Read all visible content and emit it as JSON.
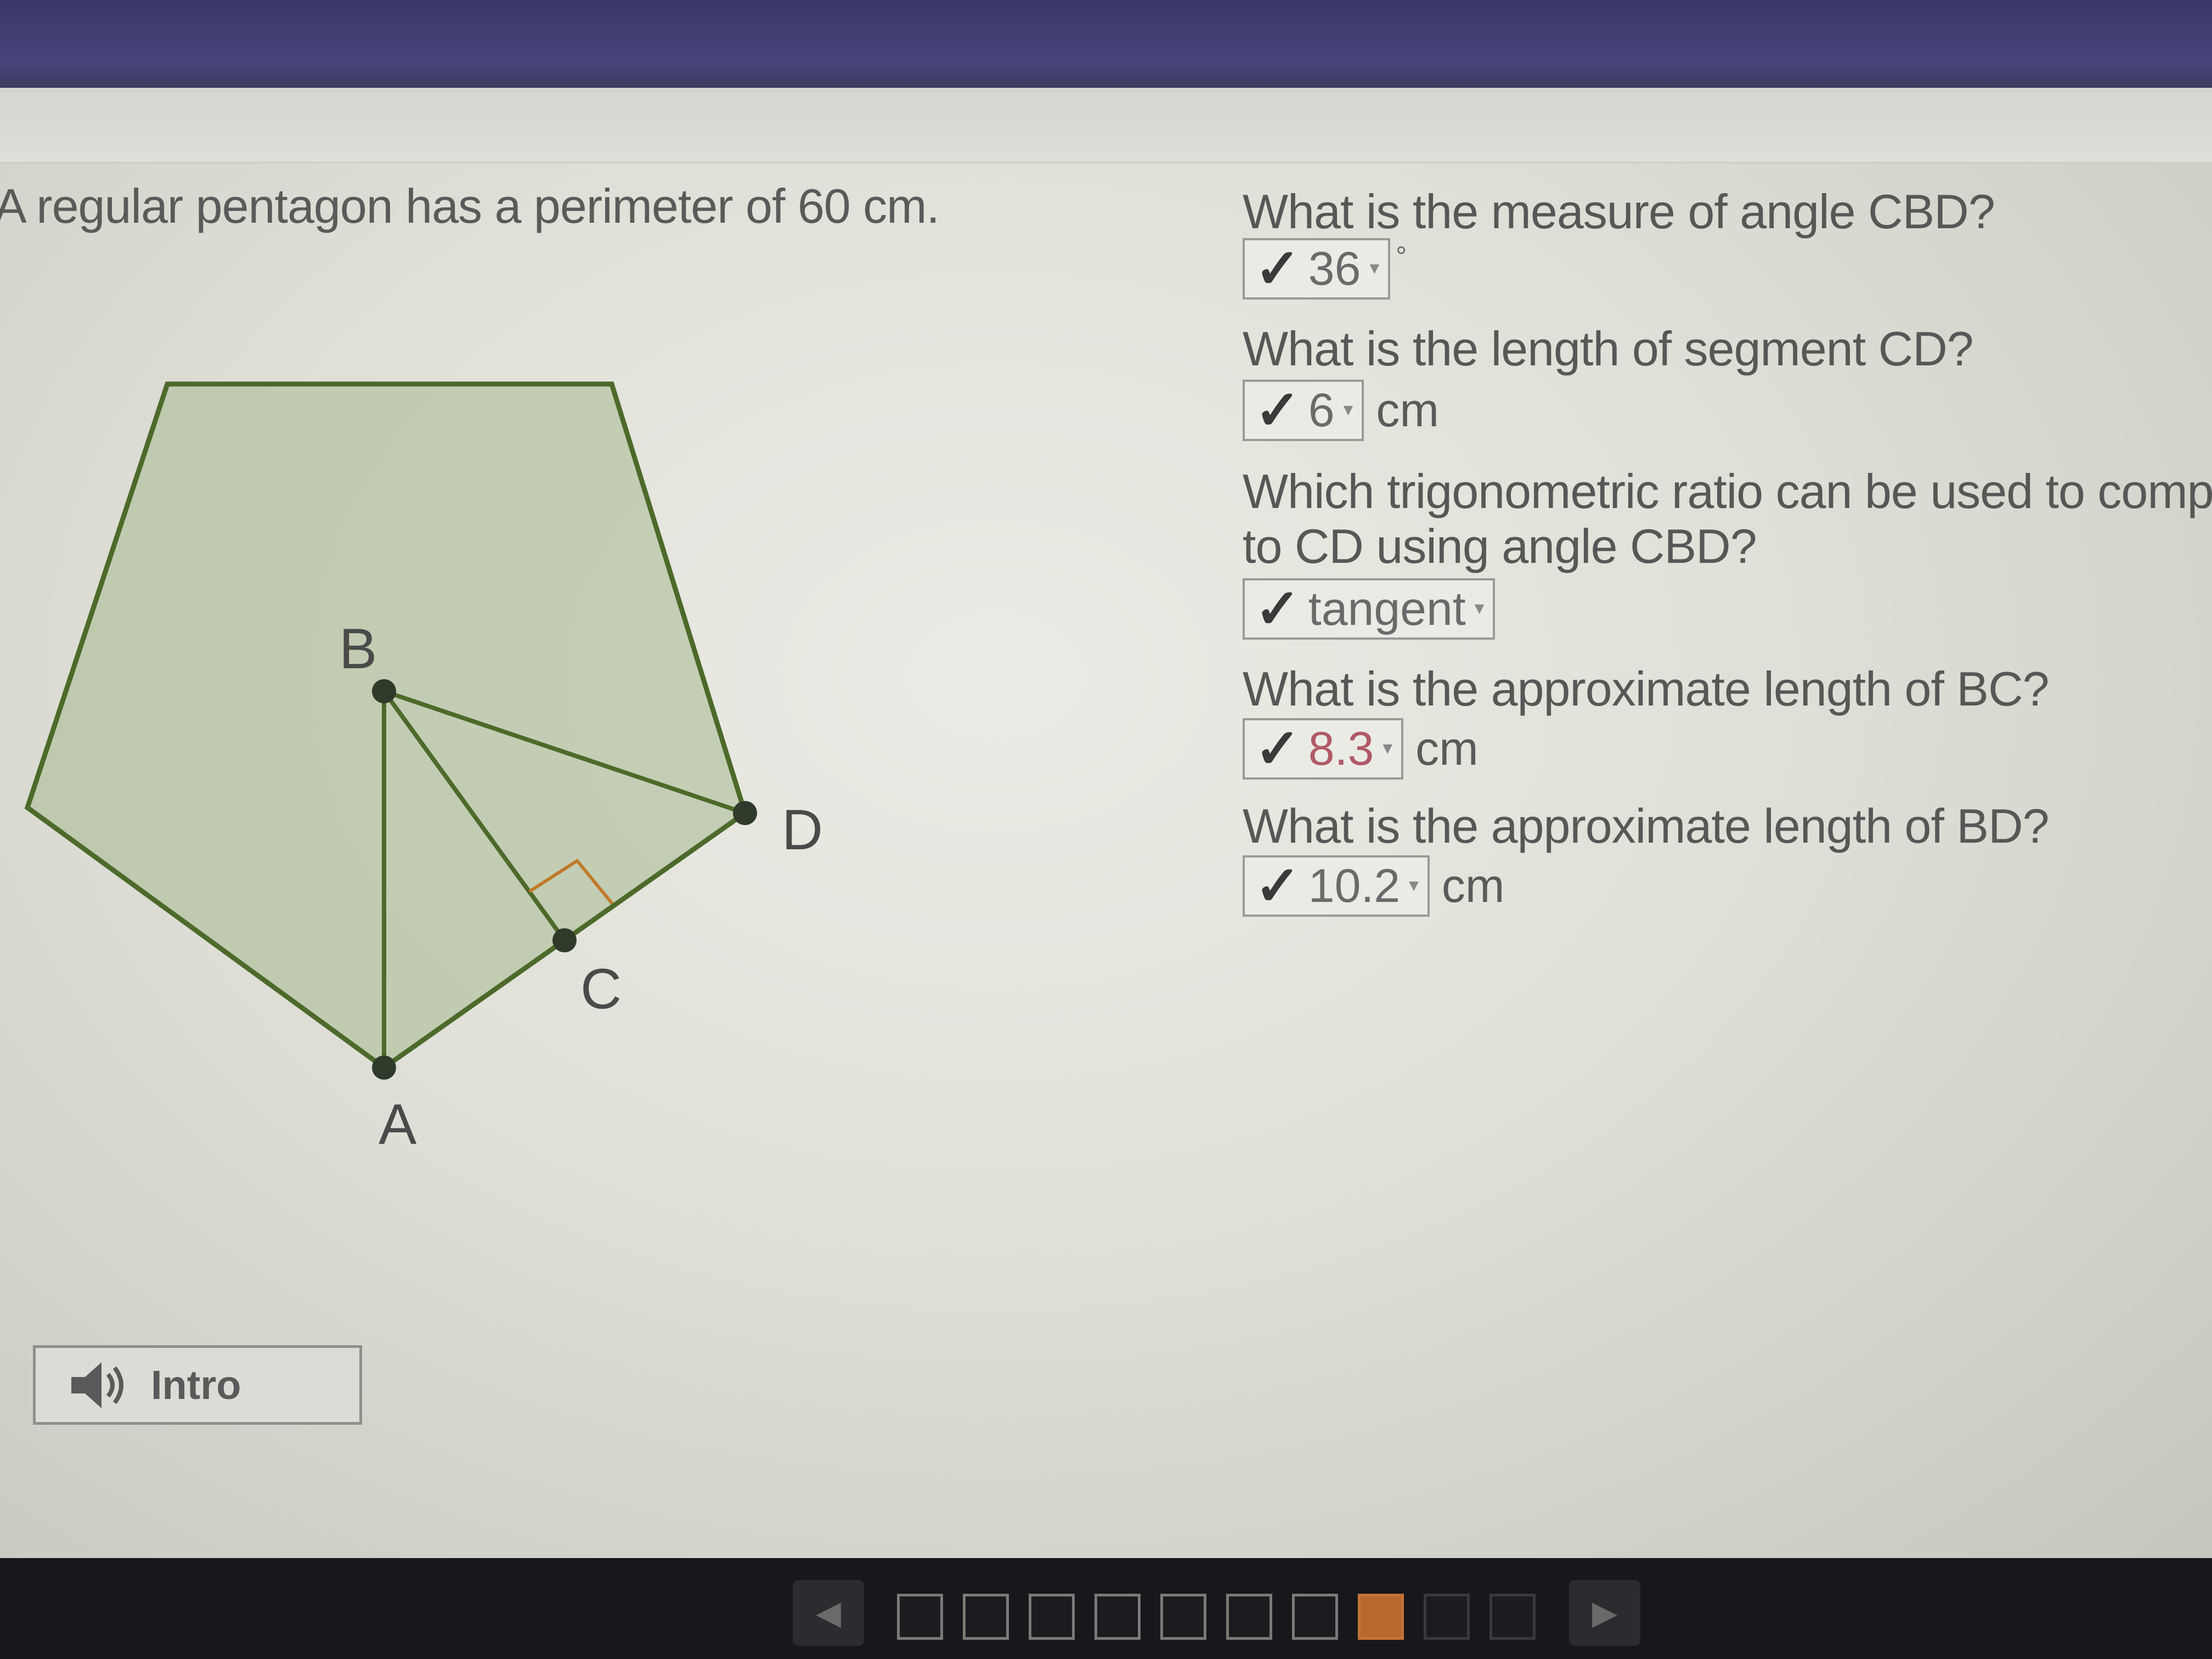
{
  "prompt": "A regular pentagon has a perimeter of 60 cm.",
  "figure": {
    "labels": {
      "A": "A",
      "B": "B",
      "C": "C",
      "D": "D"
    },
    "fill_color": "#a7b88f",
    "stroke_color": "#4c6a2a",
    "right_angle_color": "#c07a2a"
  },
  "questions": [
    {
      "text": "What is the measure of angle CBD?",
      "answer": "36",
      "unit": "°",
      "status": "correct"
    },
    {
      "text": "What is the length of segment CD?",
      "answer": "6",
      "unit": "cm",
      "status": "correct"
    },
    {
      "text": "Which trigonometric ratio can be used to comp",
      "text_line2": "to CD using angle CBD?",
      "answer": "tangent",
      "unit": "",
      "status": "correct"
    },
    {
      "text": "What is the approximate length of BC?",
      "answer": "8.3",
      "unit": "cm",
      "status": "correct"
    },
    {
      "text": "What is the approximate length of BD?",
      "answer": "10.2",
      "unit": "cm",
      "status": "correct"
    }
  ],
  "check_icon": "checkmark-icon",
  "intro_button": {
    "label": "Intro",
    "icon": "speaker-icon"
  },
  "navigation": {
    "prev_icon": "arrow-left-icon",
    "next_icon": "arrow-right-icon",
    "pages": 10,
    "current_page": 8
  },
  "colors": {
    "top_bar": "#42416f",
    "progress_current": "#b8682e",
    "answer_highlight": "#b05a66"
  }
}
